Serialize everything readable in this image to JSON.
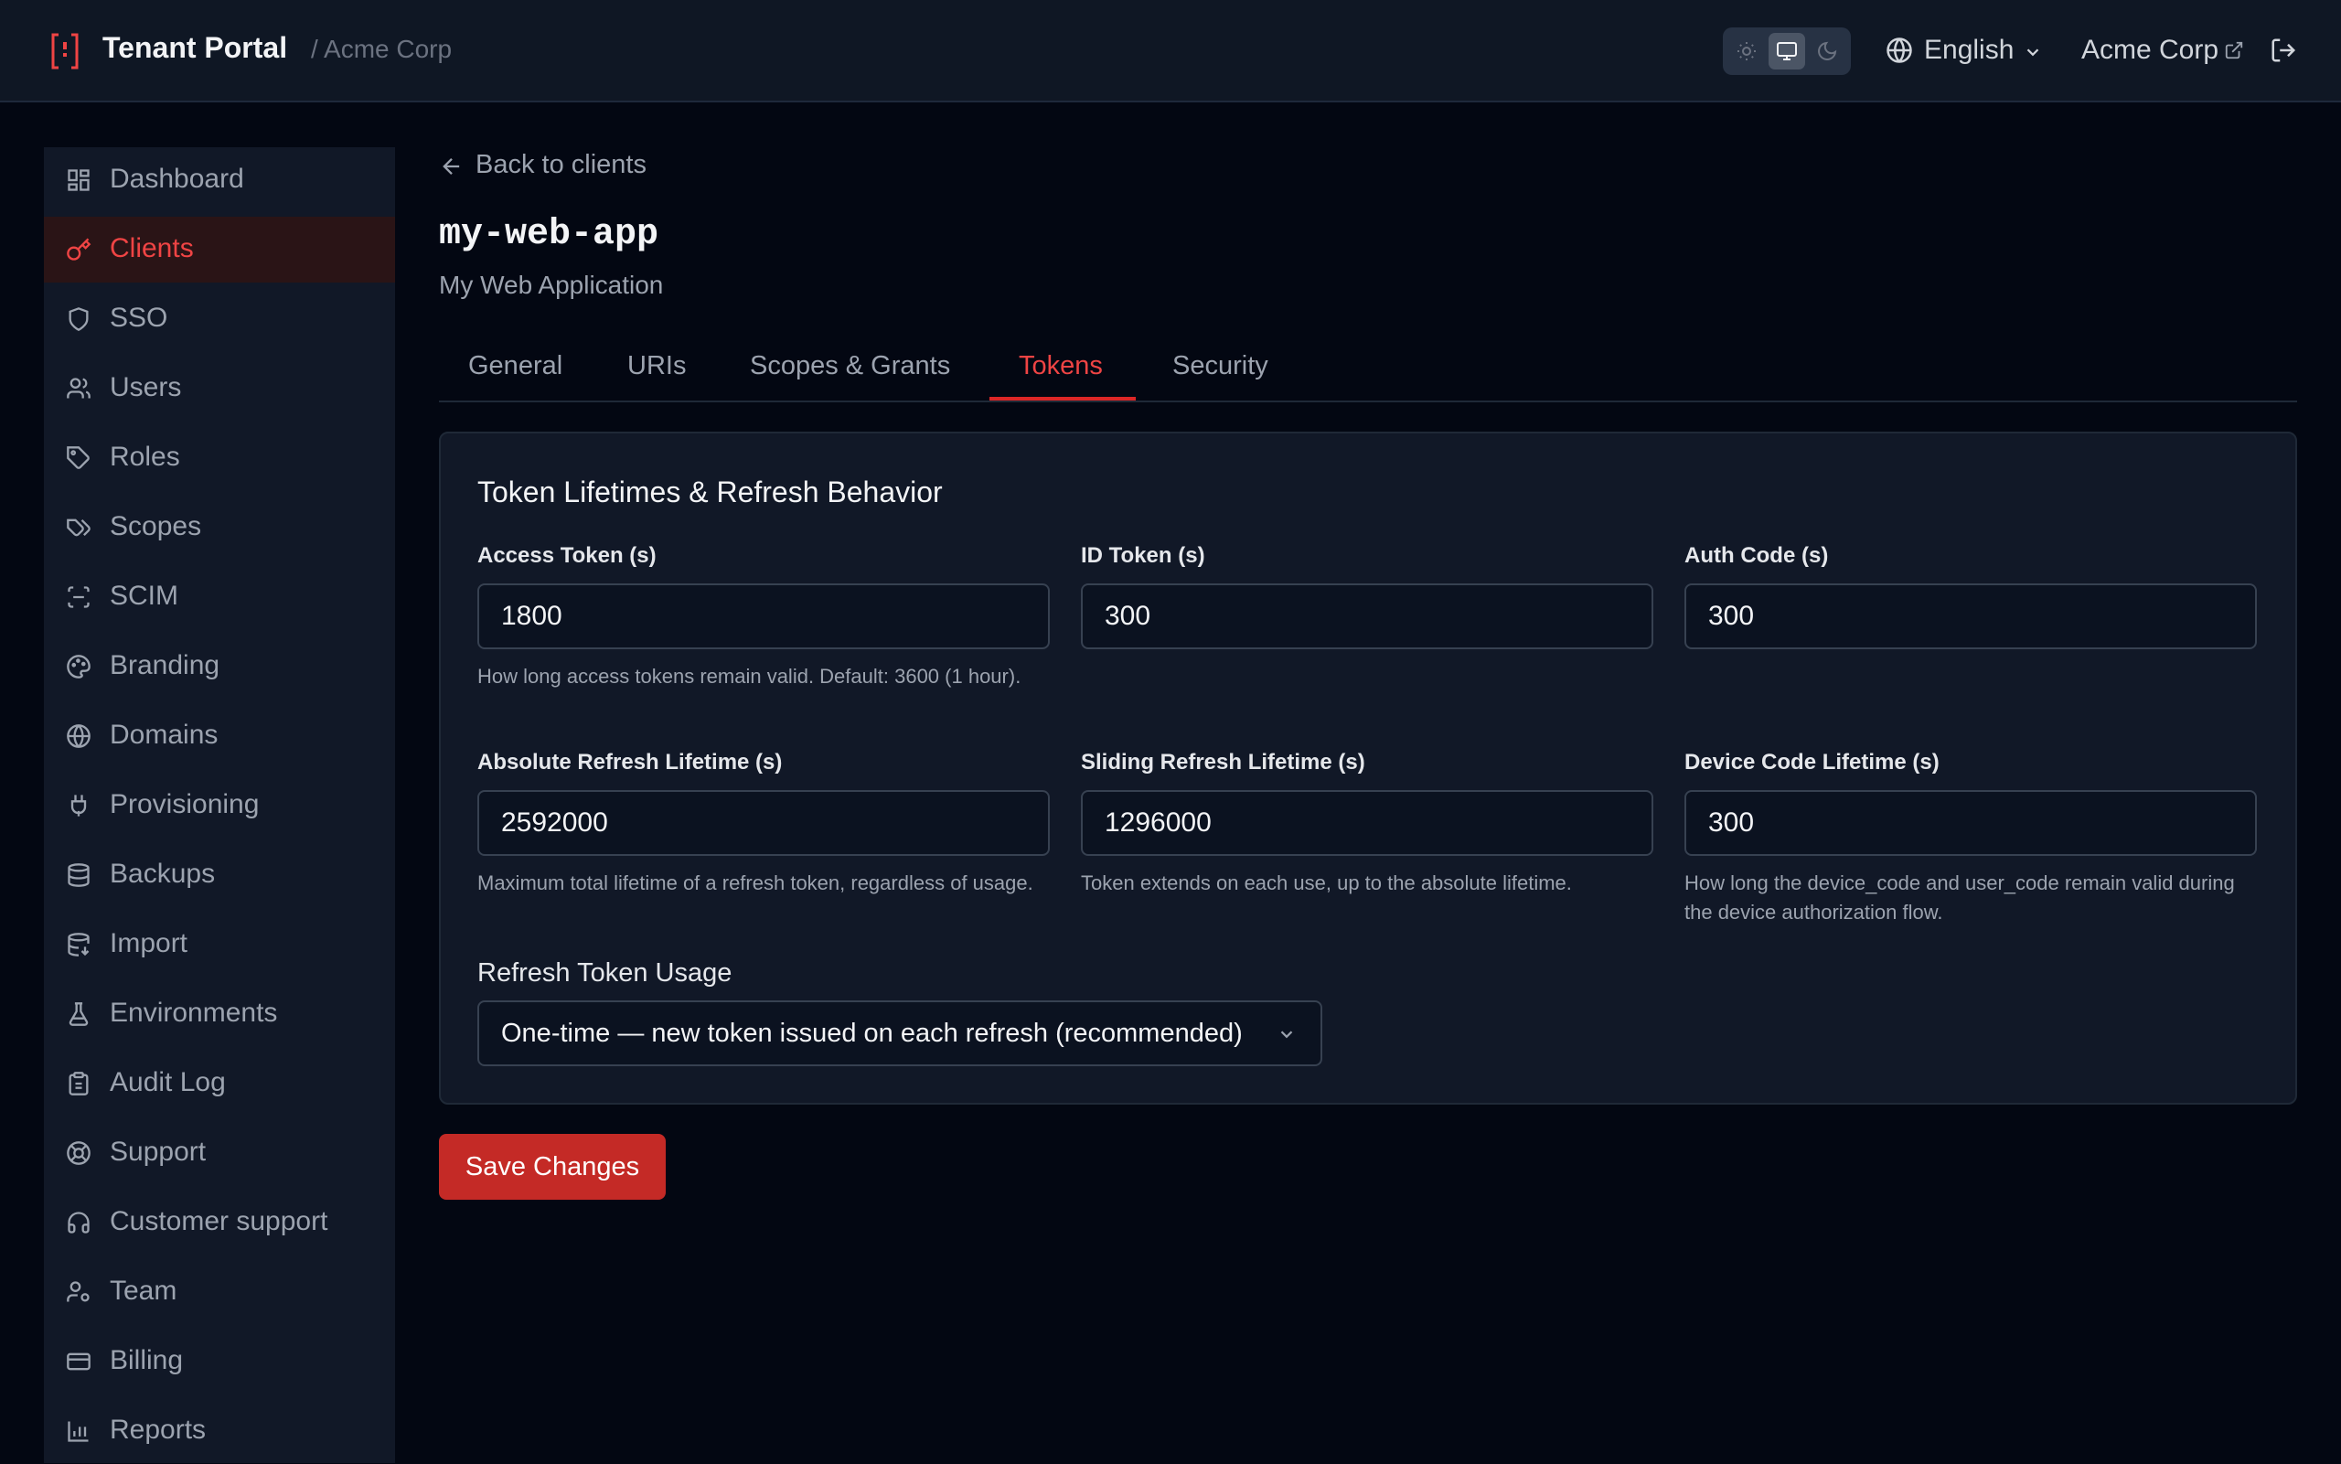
{
  "header": {
    "app_title": "Tenant Portal",
    "tenant_breadcrumb": "/ Acme Corp",
    "theme_options": [
      "light",
      "system",
      "dark"
    ],
    "theme_selected": "system",
    "language_label": "English",
    "org_link_label": "Acme Corp"
  },
  "sidebar": {
    "active": "Clients",
    "items": [
      {
        "label": "Dashboard",
        "icon": "dashboard-icon"
      },
      {
        "label": "Clients",
        "icon": "key-icon"
      },
      {
        "label": "SSO",
        "icon": "shield-icon"
      },
      {
        "label": "Users",
        "icon": "users-icon"
      },
      {
        "label": "Roles",
        "icon": "tag-icon"
      },
      {
        "label": "Scopes",
        "icon": "tags-icon"
      },
      {
        "label": "SCIM",
        "icon": "scan-icon"
      },
      {
        "label": "Branding",
        "icon": "palette-icon"
      },
      {
        "label": "Domains",
        "icon": "globe-icon"
      },
      {
        "label": "Provisioning",
        "icon": "plug-icon"
      },
      {
        "label": "Backups",
        "icon": "database-icon"
      },
      {
        "label": "Import",
        "icon": "database-import-icon"
      },
      {
        "label": "Environments",
        "icon": "flask-icon"
      },
      {
        "label": "Audit Log",
        "icon": "clipboard-icon"
      },
      {
        "label": "Support",
        "icon": "life-buoy-icon"
      },
      {
        "label": "Customer support",
        "icon": "headset-icon"
      },
      {
        "label": "Team",
        "icon": "user-cog-icon"
      },
      {
        "label": "Billing",
        "icon": "credit-card-icon"
      },
      {
        "label": "Reports",
        "icon": "bar-chart-icon"
      }
    ]
  },
  "page": {
    "back_label": "Back to clients",
    "client_id": "my-web-app",
    "client_name": "My Web Application",
    "tabs": [
      "General",
      "URIs",
      "Scopes & Grants",
      "Tokens",
      "Security"
    ],
    "active_tab": "Tokens"
  },
  "tokens_card": {
    "title": "Token Lifetimes & Refresh Behavior",
    "fields": [
      {
        "label": "Access Token (s)",
        "value": "1800",
        "help": "How long access tokens remain valid. Default: 3600 (1 hour)."
      },
      {
        "label": "ID Token (s)",
        "value": "300",
        "help": ""
      },
      {
        "label": "Auth Code (s)",
        "value": "300",
        "help": ""
      },
      {
        "label": "Absolute Refresh Lifetime (s)",
        "value": "2592000",
        "help": "Maximum total lifetime of a refresh token, regardless of usage."
      },
      {
        "label": "Sliding Refresh Lifetime (s)",
        "value": "1296000",
        "help": "Token extends on each use, up to the absolute lifetime."
      },
      {
        "label": "Device Code Lifetime (s)",
        "value": "300",
        "help": "How long the device_code and user_code remain valid during the device authorization flow."
      }
    ],
    "refresh_usage_label": "Refresh Token Usage",
    "refresh_usage_value": "One-time — new token issued on each refresh (recommended)"
  },
  "actions": {
    "save_label": "Save Changes"
  },
  "colors": {
    "accent": "#dc2626",
    "background": "#030712",
    "surface": "#111827",
    "header": "#0f1724"
  }
}
